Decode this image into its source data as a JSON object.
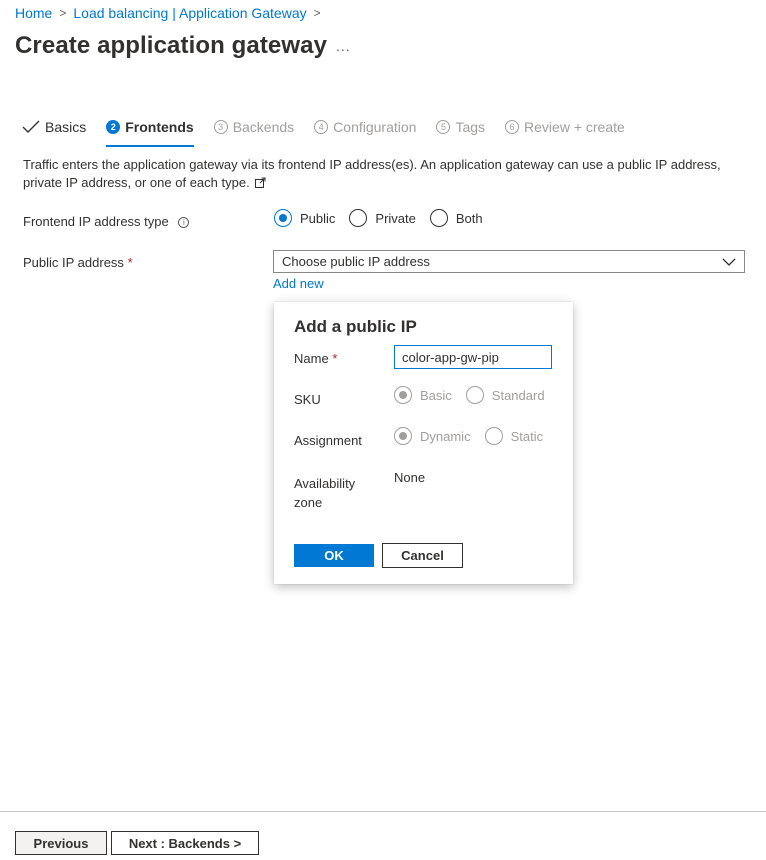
{
  "breadcrumb": {
    "home": "Home",
    "separator": ">",
    "parent": "Load balancing | Application Gateway",
    "trailing_separator": ">"
  },
  "page": {
    "title": "Create application gateway",
    "more": "..."
  },
  "tabs": [
    {
      "label": "Basics",
      "state": "done",
      "icon": "check-icon"
    },
    {
      "number": "2",
      "label": "Frontends",
      "state": "active"
    },
    {
      "number": "3",
      "label": "Backends",
      "state": "disabled"
    },
    {
      "number": "4",
      "label": "Configuration",
      "state": "disabled"
    },
    {
      "number": "5",
      "label": "Tags",
      "state": "disabled"
    },
    {
      "number": "6",
      "label": "Review + create",
      "state": "disabled"
    }
  ],
  "description": "Traffic enters the application gateway via its frontend IP address(es). An application gateway can use a public IP address, private IP address, or one of each type.",
  "form": {
    "ip_type": {
      "label": "Frontend IP address type",
      "options": [
        "Public",
        "Private",
        "Both"
      ],
      "selected": "Public"
    },
    "public_ip": {
      "label": "Public IP address",
      "required_mark": "*",
      "placeholder": "Choose public IP address",
      "add_new": "Add new"
    }
  },
  "dialog": {
    "title": "Add a public IP",
    "name_label": "Name",
    "required_mark": "*",
    "name_value": "color-app-gw-pip",
    "sku_label": "SKU",
    "sku_options": [
      "Basic",
      "Standard"
    ],
    "sku_selected": "Basic",
    "assignment_label": "Assignment",
    "assignment_options": [
      "Dynamic",
      "Static"
    ],
    "assignment_selected": "Dynamic",
    "zone_label_1": "Availability",
    "zone_label_2": "zone",
    "zone_value": "None",
    "ok": "OK",
    "cancel": "Cancel"
  },
  "footer": {
    "previous": "Previous",
    "next": "Next : Backends >"
  },
  "colors": {
    "accent": "#0078d4",
    "required": "#a4262c",
    "disabled": "#a19f9d"
  }
}
